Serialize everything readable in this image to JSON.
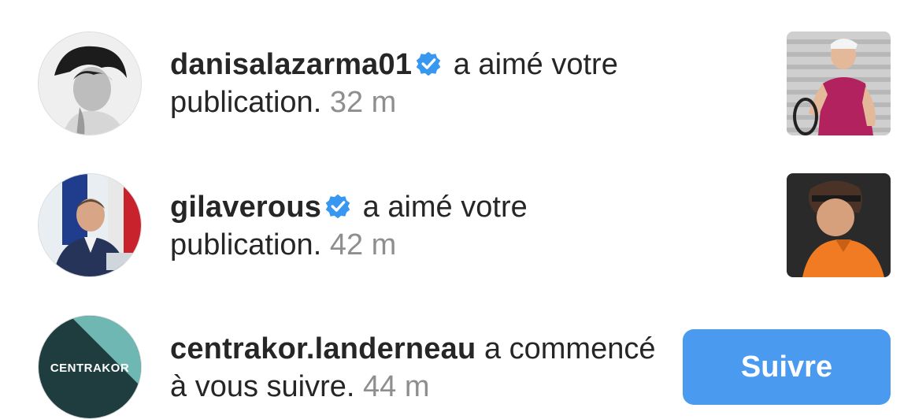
{
  "notifications": [
    {
      "username": "danisalazarma01",
      "verified": true,
      "action": " a aimé votre publication.",
      "time": "32 m",
      "trailing": "post-thumbnail"
    },
    {
      "username": "gilaverous",
      "verified": true,
      "action": " a aimé votre publication.",
      "time": "42 m",
      "trailing": "post-thumbnail"
    },
    {
      "username": "centrakor.landerneau",
      "verified": false,
      "action": " a commencé à vous suivre.",
      "time": "44 m",
      "trailing": "follow-button",
      "avatar_text": "CENTRAKOR",
      "follow_label": "Suivre"
    }
  ],
  "colors": {
    "verified_badge": "#3897f0",
    "follow_button": "#4a9af0",
    "timestamp": "#8e8e8e",
    "text": "#262626"
  }
}
